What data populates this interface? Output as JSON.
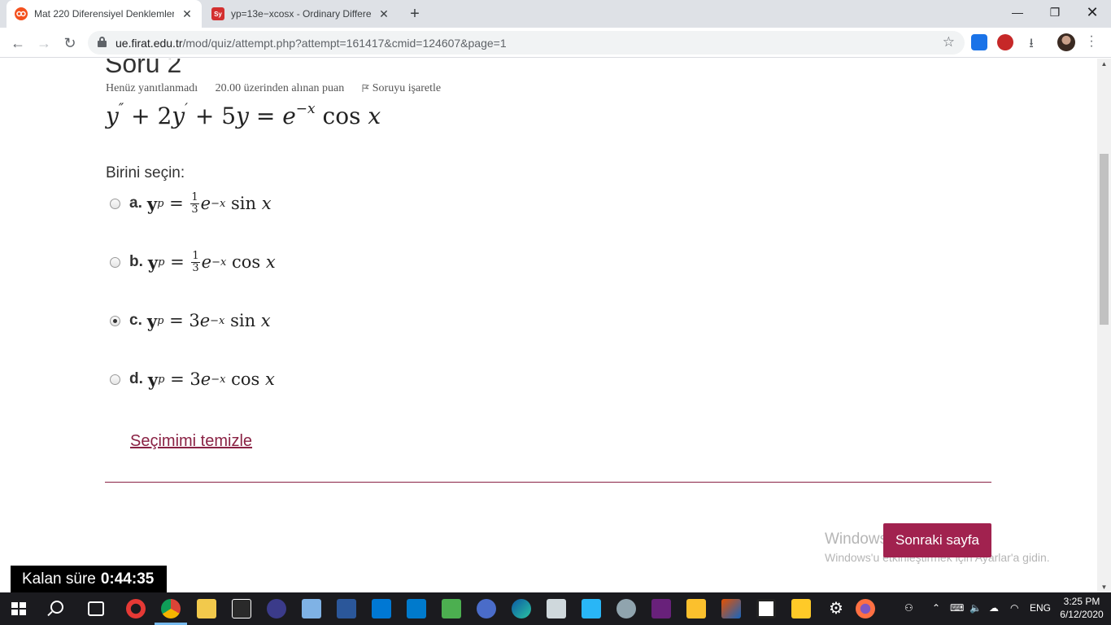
{
  "browser": {
    "tabs": [
      {
        "title": "Mat 220 Diferensiyel Denklemler",
        "active": true,
        "favicon_color": "#f4511e"
      },
      {
        "title": "yp=13e−xcosx - Ordinary Differe",
        "active": false,
        "favicon_label": "Sy",
        "favicon_color": "#d32f2f"
      }
    ],
    "url_host": "ue.firat.edu.tr",
    "url_path": "/mod/quiz/attempt.php?attempt=161417&cmid=124607&page=1"
  },
  "question": {
    "heading": "Soru 2",
    "status": "Henüz yanıtlanmadı",
    "points": "20.00 üzerinden alınan puan",
    "flag_label": "Soruyu işaretle",
    "prompt": "Birini seçin:",
    "options": [
      {
        "letter": "a.",
        "coef": "1/3",
        "func": "sin",
        "checked": false
      },
      {
        "letter": "b.",
        "coef": "1/3",
        "func": "cos",
        "checked": false
      },
      {
        "letter": "c.",
        "coef": "3",
        "func": "sin",
        "checked": true
      },
      {
        "letter": "d.",
        "coef": "3",
        "func": "cos",
        "checked": false
      }
    ],
    "clear_label": "Seçimimi temizle",
    "next_label": "Sonraki sayfa"
  },
  "watermark": {
    "line1": "Windows'u Etkinleştir",
    "line2": "Windows'u etkinleştirmek için Ayarlar'a gidin."
  },
  "timer": {
    "label": "Kalan süre",
    "value": "0:44:35"
  },
  "taskbar": {
    "language": "ENG",
    "time": "3:25 PM",
    "date": "6/12/2020"
  },
  "colors": {
    "accent": "#a1224f",
    "link": "#8a2244"
  }
}
